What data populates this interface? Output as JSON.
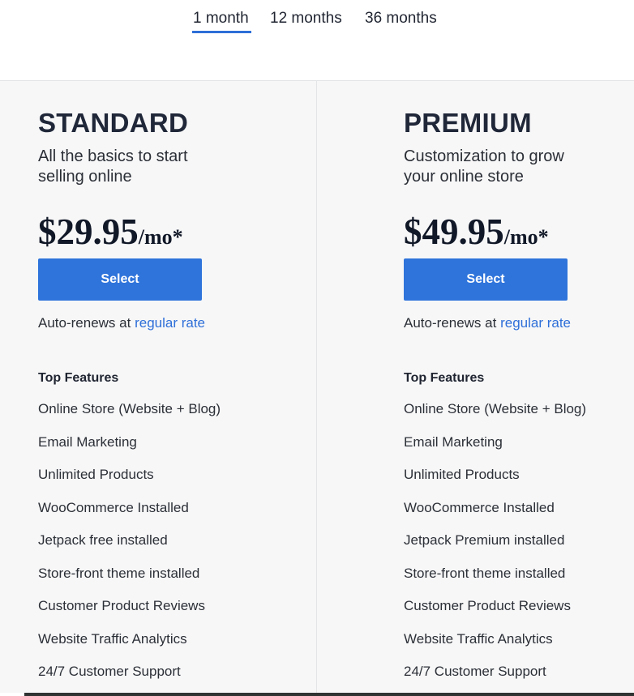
{
  "tabs": [
    {
      "label": "1 month",
      "active": true
    },
    {
      "label": "12 months",
      "active": false
    },
    {
      "label": "36 months",
      "active": false
    }
  ],
  "accent_color": "#2e6fd8",
  "plans": [
    {
      "name": "STANDARD",
      "description": "All the basics to start selling online",
      "price": "$29.95",
      "price_unit": "/mo*",
      "select_label": "Select",
      "renew_text": "Auto-renews at",
      "renew_link": "regular rate",
      "features_title": "Top Features",
      "features": [
        "Online Store (Website + Blog)",
        "Email Marketing",
        "Unlimited Products",
        "WooCommerce Installed",
        "Jetpack free installed",
        "Store-front theme installed",
        "Customer Product Reviews",
        "Website Traffic Analytics",
        "24/7 Customer Support"
      ]
    },
    {
      "name": "PREMIUM",
      "description": "Customization to grow your online store",
      "price": "$49.95",
      "price_unit": "/mo*",
      "select_label": "Select",
      "renew_text": "Auto-renews at",
      "renew_link": "regular rate",
      "features_title": "Top Features",
      "features": [
        "Online Store (Website + Blog)",
        "Email Marketing",
        "Unlimited Products",
        "WooCommerce Installed",
        "Jetpack Premium installed",
        "Store-front theme installed",
        "Customer Product Reviews",
        "Website Traffic Analytics",
        "24/7 Customer Support"
      ]
    }
  ]
}
